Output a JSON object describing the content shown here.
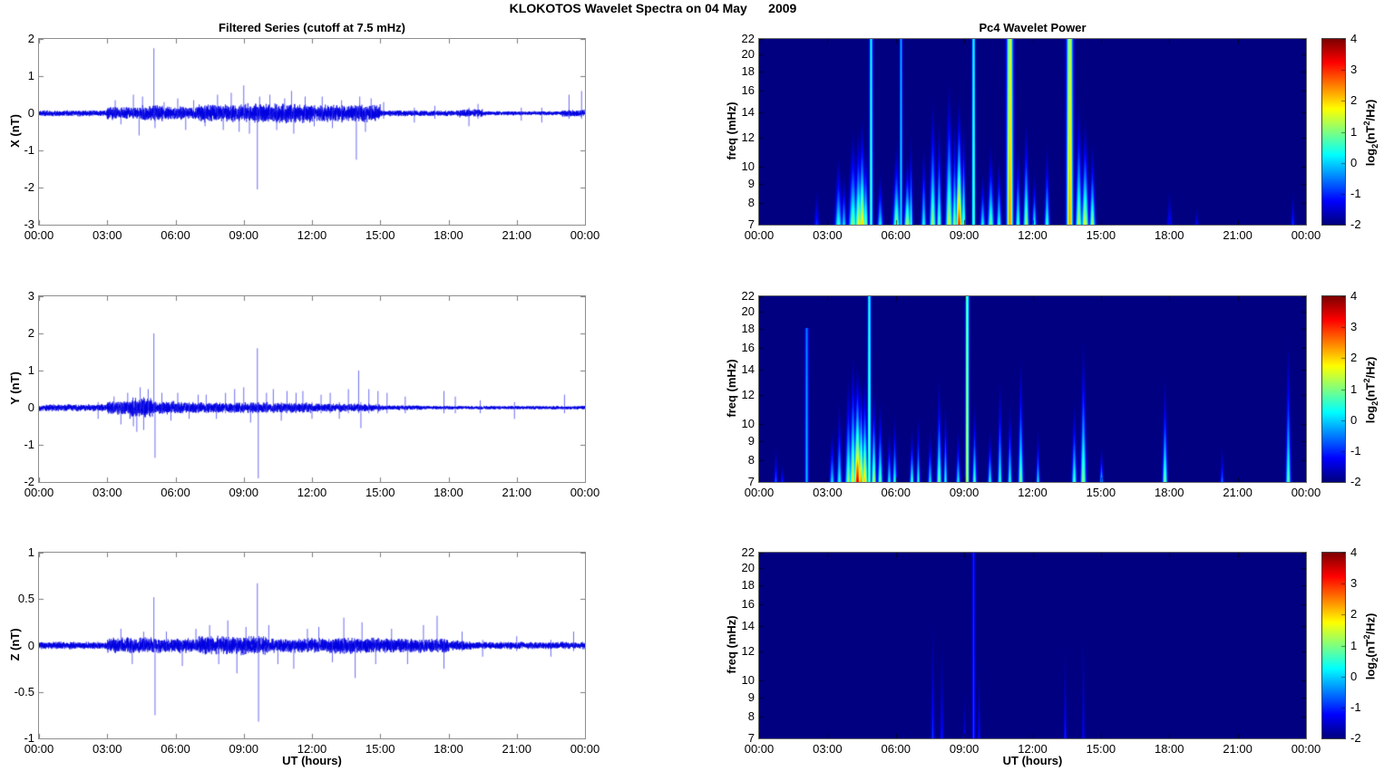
{
  "figure_title": "KLOKOTOS Wavelet Spectra on 04 May      2009",
  "axes": {
    "xlabel": "UT (hours)",
    "x_range_hours": [
      0,
      24
    ],
    "x_tick_hours": [
      0,
      3,
      6,
      9,
      12,
      15,
      18,
      21,
      24
    ],
    "x_tick_labels": [
      "00:00",
      "03:00",
      "06:00",
      "09:00",
      "12:00",
      "15:00",
      "18:00",
      "21:00",
      "00:00"
    ]
  },
  "colorbar": {
    "range": [
      -2,
      4
    ],
    "ticks": [
      4,
      3,
      2,
      1,
      0,
      -1,
      -2
    ],
    "label_pre": "log",
    "label_sub": "2",
    "label_mid": "(nT",
    "label_sup": "2",
    "label_post": "/Hz)"
  },
  "colors": {
    "trace": "#0000e0",
    "spec_background": "#000080",
    "jet_min": "#000080",
    "jet_max": "#800000",
    "text": "#000000"
  },
  "chart_data": [
    {
      "id": "ts-x",
      "type": "line",
      "title": "Filtered Series (cutoff at 7.5 mHz)",
      "ylabel": "X (nT)",
      "ylim": [
        -3,
        2
      ],
      "yticks": [
        2,
        1,
        0,
        -1,
        -2,
        -3
      ],
      "seed": 11,
      "noise_envelope": [
        [
          0,
          3,
          0.05
        ],
        [
          3,
          4.5,
          0.11
        ],
        [
          4.5,
          5.5,
          0.14
        ],
        [
          5.5,
          7,
          0.11
        ],
        [
          7,
          9,
          0.15
        ],
        [
          9,
          12,
          0.17
        ],
        [
          12,
          15,
          0.15
        ],
        [
          15,
          18.5,
          0.05
        ],
        [
          18.5,
          19.5,
          0.07
        ],
        [
          19.5,
          23,
          0.035
        ],
        [
          23,
          24,
          0.06
        ]
      ],
      "spikes": [
        [
          3.35,
          0.35
        ],
        [
          3.6,
          -0.3
        ],
        [
          4.15,
          0.5
        ],
        [
          4.4,
          -0.6
        ],
        [
          4.55,
          0.45
        ],
        [
          5.05,
          1.75
        ],
        [
          5.1,
          -0.4
        ],
        [
          5.5,
          0.3
        ],
        [
          6.1,
          0.4
        ],
        [
          6.45,
          -0.45
        ],
        [
          6.8,
          0.35
        ],
        [
          7.3,
          -0.35
        ],
        [
          7.85,
          0.5
        ],
        [
          8.1,
          -0.45
        ],
        [
          8.45,
          0.55
        ],
        [
          8.8,
          -0.5
        ],
        [
          9.0,
          0.75
        ],
        [
          9.25,
          -0.55
        ],
        [
          9.6,
          -2.05
        ],
        [
          9.7,
          0.45
        ],
        [
          10.15,
          0.5
        ],
        [
          10.45,
          -0.45
        ],
        [
          10.8,
          0.4
        ],
        [
          11.1,
          0.6
        ],
        [
          11.2,
          -0.55
        ],
        [
          11.7,
          0.45
        ],
        [
          12.1,
          -0.35
        ],
        [
          12.45,
          0.45
        ],
        [
          12.9,
          -0.4
        ],
        [
          13.3,
          0.35
        ],
        [
          13.95,
          -1.25
        ],
        [
          14.1,
          0.45
        ],
        [
          14.35,
          -0.5
        ],
        [
          14.6,
          0.4
        ],
        [
          15.15,
          0.3
        ],
        [
          16.5,
          -0.25
        ],
        [
          17.4,
          0.2
        ],
        [
          18.9,
          -0.35
        ],
        [
          19.3,
          0.25
        ],
        [
          21.2,
          -0.2
        ],
        [
          22.1,
          -0.25
        ],
        [
          23.3,
          0.5
        ],
        [
          23.85,
          0.6
        ]
      ]
    },
    {
      "id": "ts-y",
      "type": "line",
      "ylabel": "Y (nT)",
      "ylim": [
        -2,
        3
      ],
      "yticks": [
        3,
        2,
        1,
        0,
        -1,
        -2
      ],
      "seed": 22,
      "noise_envelope": [
        [
          0,
          3,
          0.06
        ],
        [
          3,
          4,
          0.12
        ],
        [
          4,
          5,
          0.18
        ],
        [
          5,
          6.5,
          0.11
        ],
        [
          6.5,
          9,
          0.09
        ],
        [
          9,
          12,
          0.09
        ],
        [
          12,
          15,
          0.07
        ],
        [
          15,
          17,
          0.04
        ],
        [
          17,
          24,
          0.03
        ]
      ],
      "spikes": [
        [
          2.6,
          -0.3
        ],
        [
          3.3,
          0.3
        ],
        [
          3.6,
          -0.45
        ],
        [
          3.9,
          0.4
        ],
        [
          4.15,
          -0.5
        ],
        [
          4.3,
          -0.65
        ],
        [
          4.45,
          0.55
        ],
        [
          4.6,
          -0.6
        ],
        [
          4.8,
          0.5
        ],
        [
          5.05,
          2.0
        ],
        [
          5.1,
          -1.35
        ],
        [
          5.4,
          0.4
        ],
        [
          5.8,
          -0.35
        ],
        [
          6.1,
          0.4
        ],
        [
          6.6,
          -0.3
        ],
        [
          7.0,
          0.35
        ],
        [
          7.35,
          0.35
        ],
        [
          7.8,
          -0.3
        ],
        [
          8.2,
          0.4
        ],
        [
          8.6,
          0.5
        ],
        [
          9.0,
          0.55
        ],
        [
          9.3,
          -0.4
        ],
        [
          9.6,
          1.6
        ],
        [
          9.64,
          -1.9
        ],
        [
          10.0,
          0.4
        ],
        [
          10.3,
          0.5
        ],
        [
          10.65,
          -0.35
        ],
        [
          10.9,
          0.45
        ],
        [
          11.3,
          0.4
        ],
        [
          11.6,
          0.45
        ],
        [
          12.0,
          -0.3
        ],
        [
          12.4,
          0.35
        ],
        [
          12.8,
          0.4
        ],
        [
          13.2,
          -0.3
        ],
        [
          13.6,
          0.5
        ],
        [
          14.05,
          1.0
        ],
        [
          14.15,
          -0.55
        ],
        [
          14.5,
          0.5
        ],
        [
          14.9,
          0.45
        ],
        [
          15.3,
          0.4
        ],
        [
          16.1,
          0.3
        ],
        [
          17.8,
          0.45
        ],
        [
          18.3,
          0.3
        ],
        [
          19.4,
          0.2
        ],
        [
          20.9,
          -0.3
        ],
        [
          23.1,
          0.35
        ]
      ]
    },
    {
      "id": "ts-z",
      "type": "line",
      "ylabel": "Z (nT)",
      "ylim": [
        -1,
        1
      ],
      "yticks": [
        1,
        0.5,
        0,
        -0.5,
        -1
      ],
      "seed": 33,
      "noise_envelope": [
        [
          0,
          3,
          0.025
        ],
        [
          3,
          5,
          0.055
        ],
        [
          5,
          7,
          0.05
        ],
        [
          7,
          10,
          0.065
        ],
        [
          10,
          13,
          0.05
        ],
        [
          13,
          15,
          0.055
        ],
        [
          15,
          18,
          0.05
        ],
        [
          18,
          19,
          0.035
        ],
        [
          19,
          24,
          0.025
        ]
      ],
      "spikes": [
        [
          3.6,
          0.18
        ],
        [
          4.1,
          -0.2
        ],
        [
          4.6,
          0.15
        ],
        [
          5.05,
          0.52
        ],
        [
          5.1,
          -0.75
        ],
        [
          5.6,
          0.15
        ],
        [
          6.3,
          -0.22
        ],
        [
          6.9,
          0.18
        ],
        [
          7.5,
          0.22
        ],
        [
          7.9,
          -0.2
        ],
        [
          8.3,
          0.27
        ],
        [
          8.7,
          -0.3
        ],
        [
          9.1,
          0.2
        ],
        [
          9.6,
          0.67
        ],
        [
          9.65,
          -0.82
        ],
        [
          10.1,
          0.22
        ],
        [
          10.5,
          -0.2
        ],
        [
          11.2,
          -0.25
        ],
        [
          11.8,
          0.18
        ],
        [
          12.3,
          0.2
        ],
        [
          12.9,
          -0.18
        ],
        [
          13.4,
          0.3
        ],
        [
          13.9,
          -0.35
        ],
        [
          14.2,
          0.25
        ],
        [
          14.8,
          -0.2
        ],
        [
          15.5,
          0.18
        ],
        [
          16.2,
          -0.2
        ],
        [
          16.9,
          0.22
        ],
        [
          17.5,
          0.32
        ],
        [
          17.8,
          -0.25
        ],
        [
          18.6,
          0.15
        ],
        [
          19.5,
          -0.12
        ],
        [
          21.0,
          0.1
        ],
        [
          22.5,
          -0.12
        ],
        [
          23.5,
          0.15
        ]
      ]
    },
    {
      "id": "spec-x",
      "type": "heatmap",
      "title": "Pc4 Wavelet Power",
      "ylabel": "freq (mHz)",
      "ylim": [
        7,
        22
      ],
      "yscale": "log",
      "yticks": [
        22,
        20,
        18,
        16,
        14,
        12,
        10,
        9,
        8,
        7
      ],
      "value_range": [
        -2,
        4
      ],
      "events": [
        [
          2.5,
          9,
          -0.9,
          0.07,
          0
        ],
        [
          3.45,
          11,
          0.6,
          0.1,
          0
        ],
        [
          3.7,
          10,
          0.2,
          0.07,
          0
        ],
        [
          4.1,
          13,
          1.1,
          0.12,
          0
        ],
        [
          4.35,
          13,
          1.7,
          0.1,
          0
        ],
        [
          4.5,
          14,
          2.2,
          0.1,
          0
        ],
        [
          4.65,
          12,
          1.2,
          0.07,
          0
        ],
        [
          4.9,
          22,
          0.9,
          0.05,
          1
        ],
        [
          5.3,
          10,
          0.3,
          0.08,
          0
        ],
        [
          6.0,
          12,
          1.2,
          0.1,
          0
        ],
        [
          6.2,
          22,
          0.3,
          0.04,
          1
        ],
        [
          6.5,
          11,
          1.5,
          0.09,
          0
        ],
        [
          6.65,
          13,
          0.8,
          0.05,
          0
        ],
        [
          7.2,
          12,
          0.5,
          0.07,
          0
        ],
        [
          7.6,
          16,
          1.3,
          0.09,
          0
        ],
        [
          7.9,
          14,
          1.0,
          0.07,
          0
        ],
        [
          8.3,
          18,
          1.6,
          0.1,
          0
        ],
        [
          8.55,
          14,
          1.1,
          0.07,
          0
        ],
        [
          8.75,
          16,
          3.2,
          0.09,
          0
        ],
        [
          8.95,
          14,
          1.3,
          0.06,
          0
        ],
        [
          9.4,
          22,
          1.1,
          0.05,
          1
        ],
        [
          9.8,
          10,
          0.4,
          0.07,
          0
        ],
        [
          10.15,
          12,
          1.0,
          0.09,
          0
        ],
        [
          10.5,
          11,
          0.6,
          0.07,
          0
        ],
        [
          11.0,
          22,
          2.5,
          0.09,
          1
        ],
        [
          11.35,
          12,
          0.8,
          0.07,
          0
        ],
        [
          11.7,
          14,
          1.3,
          0.08,
          0
        ],
        [
          12.05,
          10,
          0.5,
          0.06,
          0
        ],
        [
          12.6,
          12,
          0.7,
          0.07,
          0
        ],
        [
          13.6,
          22,
          2.4,
          0.09,
          1
        ],
        [
          14.0,
          16,
          1.4,
          0.09,
          0
        ],
        [
          14.3,
          14,
          1.7,
          0.1,
          0
        ],
        [
          14.6,
          12,
          1.3,
          0.08,
          0
        ],
        [
          18.0,
          9,
          -1.0,
          0.07,
          0
        ],
        [
          19.2,
          8,
          -1.2,
          0.05,
          0
        ],
        [
          23.4,
          9,
          -0.9,
          0.05,
          0
        ]
      ]
    },
    {
      "id": "spec-y",
      "type": "heatmap",
      "ylabel": "freq (mHz)",
      "ylim": [
        7,
        22
      ],
      "yscale": "log",
      "yticks": [
        22,
        20,
        18,
        16,
        14,
        12,
        10,
        9,
        8,
        7
      ],
      "value_range": [
        -2,
        4
      ],
      "events": [
        [
          0.7,
          9,
          -0.6,
          0.05,
          0
        ],
        [
          1.0,
          8,
          -1.0,
          0.05,
          0
        ],
        [
          2.05,
          18,
          -0.1,
          0.05,
          1
        ],
        [
          3.2,
          10,
          0.2,
          0.07,
          0
        ],
        [
          3.5,
          12,
          0.5,
          0.07,
          0
        ],
        [
          3.9,
          14,
          1.2,
          0.09,
          0
        ],
        [
          4.1,
          16,
          1.8,
          0.09,
          0
        ],
        [
          4.3,
          15,
          3.6,
          0.1,
          0
        ],
        [
          4.45,
          14,
          2.7,
          0.07,
          0
        ],
        [
          4.62,
          14,
          2.2,
          0.09,
          0
        ],
        [
          4.8,
          22,
          1.2,
          0.05,
          1
        ],
        [
          5.0,
          13,
          1.6,
          0.07,
          0
        ],
        [
          5.3,
          12,
          1.0,
          0.07,
          0
        ],
        [
          5.7,
          10,
          0.4,
          0.06,
          0
        ],
        [
          5.95,
          11,
          0.6,
          0.06,
          0
        ],
        [
          6.7,
          10,
          0.8,
          0.06,
          0
        ],
        [
          6.95,
          11,
          0.6,
          0.05,
          0
        ],
        [
          7.5,
          10,
          0.3,
          0.06,
          0
        ],
        [
          7.9,
          14,
          1.1,
          0.07,
          0
        ],
        [
          8.15,
          12,
          0.6,
          0.05,
          0
        ],
        [
          8.7,
          10,
          0.4,
          0.06,
          0
        ],
        [
          9.1,
          22,
          1.9,
          0.05,
          1
        ],
        [
          9.45,
          12,
          0.8,
          0.06,
          0
        ],
        [
          10.1,
          10,
          0.5,
          0.06,
          0
        ],
        [
          10.55,
          14,
          0.7,
          0.06,
          0
        ],
        [
          11.0,
          12,
          0.6,
          0.06,
          0
        ],
        [
          11.45,
          16,
          1.1,
          0.07,
          0
        ],
        [
          12.2,
          10,
          0.3,
          0.05,
          0
        ],
        [
          13.8,
          12,
          0.8,
          0.07,
          0
        ],
        [
          14.2,
          18,
          1.3,
          0.08,
          0
        ],
        [
          15.0,
          9,
          0.2,
          0.05,
          0
        ],
        [
          17.8,
          14,
          1.1,
          0.07,
          0
        ],
        [
          20.3,
          9,
          -0.5,
          0.05,
          0
        ],
        [
          23.2,
          18,
          0.9,
          0.07,
          0
        ]
      ]
    },
    {
      "id": "spec-z",
      "type": "heatmap",
      "ylabel": "freq (mHz)",
      "ylim": [
        7,
        22
      ],
      "yscale": "log",
      "yticks": [
        22,
        20,
        18,
        16,
        14,
        12,
        10,
        9,
        8,
        7
      ],
      "value_range": [
        -2,
        4
      ],
      "events": [
        [
          7.6,
          16,
          -0.9,
          0.05,
          0
        ],
        [
          8.0,
          14,
          -1.1,
          0.05,
          0
        ],
        [
          9.0,
          10,
          -1.3,
          0.04,
          0
        ],
        [
          9.4,
          22,
          -0.8,
          0.04,
          1
        ],
        [
          9.65,
          12,
          -1.1,
          0.04,
          0
        ],
        [
          13.4,
          14,
          -1.0,
          0.04,
          0
        ],
        [
          14.2,
          16,
          -1.2,
          0.04,
          0
        ]
      ]
    }
  ]
}
